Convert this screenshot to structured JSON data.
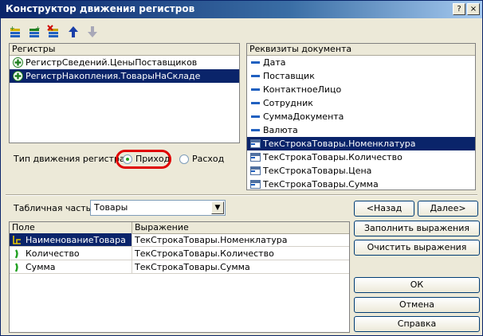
{
  "window": {
    "title": "Конструктор движения регистров",
    "help_btn": "?",
    "close_btn": "×"
  },
  "toolbar": {
    "icons": [
      "add-register-icon",
      "add-all-icon",
      "delete-register-icon",
      "move-up-icon",
      "move-down-icon"
    ]
  },
  "registers": {
    "header": "Регистры",
    "items": [
      {
        "label": "РегистрСведений.ЦеныПоставщиков",
        "selected": false
      },
      {
        "label": "РегистрНакопления.ТоварыНаСкладе",
        "selected": true
      }
    ]
  },
  "movement_type": {
    "label": "Тип движения регистра:",
    "option1": "Приход",
    "option2": "Расход",
    "selected": "Приход"
  },
  "requisites": {
    "header": "Реквизиты документа",
    "items": [
      {
        "label": "Дата",
        "type": "attr"
      },
      {
        "label": "Поставщик",
        "type": "attr"
      },
      {
        "label": "КонтактноеЛицо",
        "type": "attr"
      },
      {
        "label": "Сотрудник",
        "type": "attr"
      },
      {
        "label": "СуммаДокумента",
        "type": "attr"
      },
      {
        "label": "Валюта",
        "type": "attr"
      },
      {
        "label": "ТекСтрокаТовары.Номенклатура",
        "type": "table",
        "selected": true
      },
      {
        "label": "ТекСтрокаТовары.Количество",
        "type": "table"
      },
      {
        "label": "ТекСтрокаТовары.Цена",
        "type": "table"
      },
      {
        "label": "ТекСтрокаТовары.Сумма",
        "type": "table"
      }
    ]
  },
  "tabular_part": {
    "label": "Табличная часть:",
    "value": "Товары"
  },
  "grid": {
    "col_field": "Поле",
    "col_expr": "Выражение",
    "rows": [
      {
        "field": "НаименованиеТовара",
        "expr": "ТекСтрокаТовары.Номенклатура",
        "selected": true
      },
      {
        "field": "Количество",
        "expr": "ТекСтрокаТовары.Количество"
      },
      {
        "field": "Сумма",
        "expr": "ТекСтрокаТовары.Сумма"
      }
    ]
  },
  "buttons": {
    "back": "<Назад",
    "next": "Далее>",
    "fill": "Заполнить выражения",
    "clear": "Очистить выражения",
    "ok": "ОК",
    "cancel": "Отмена",
    "help": "Справка"
  },
  "colors": {
    "selection": "#0a246a",
    "highlight_ring": "#e00000",
    "attr_icon": "#2060c0",
    "resource_icon": "#20a020"
  }
}
